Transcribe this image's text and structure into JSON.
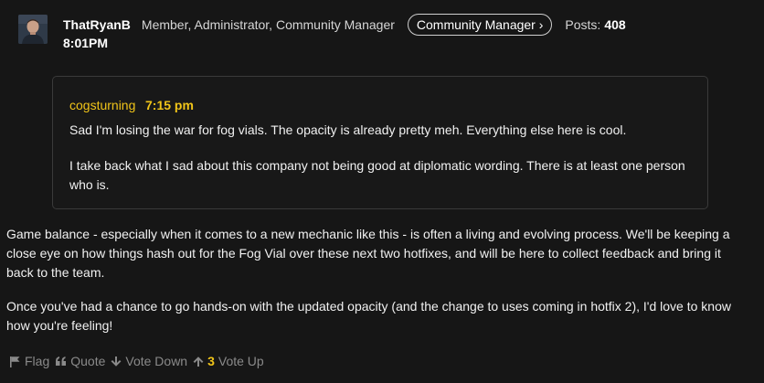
{
  "post": {
    "author": "ThatRyanB",
    "roles": "Member, Administrator, Community Manager",
    "role_badge": "Community Manager ›",
    "posts_label": "Posts:",
    "posts_count": "408",
    "timestamp": "8:01PM"
  },
  "quote": {
    "author": "cogsturning",
    "time": "7:15 pm",
    "paragraphs": [
      "Sad I'm losing the war for fog vials. The opacity is already pretty meh. Everything else here is cool.",
      "I take back what I sad about this company not being good at diplomatic wording. There is at least one person who is."
    ]
  },
  "body": {
    "paragraphs": [
      "Game balance - especially when it comes to a new mechanic like this - is often a living and evolving process. We'll be keeping a close eye on how things hash out for the Fog Vial over these next two hotfixes, and will be here to collect feedback and bring it back to the team.",
      "Once you've had a chance to go hands-on with the updated opacity (and the change to uses coming in hotfix 2), I'd love to know how you're feeling!"
    ]
  },
  "actions": {
    "flag": "Flag",
    "quote": "Quote",
    "vote_down": "Vote Down",
    "vote_count": "3",
    "vote_up": "Vote Up"
  },
  "colors": {
    "background": "#161616",
    "accent": "#f0c419",
    "muted": "#8a8a8a"
  }
}
